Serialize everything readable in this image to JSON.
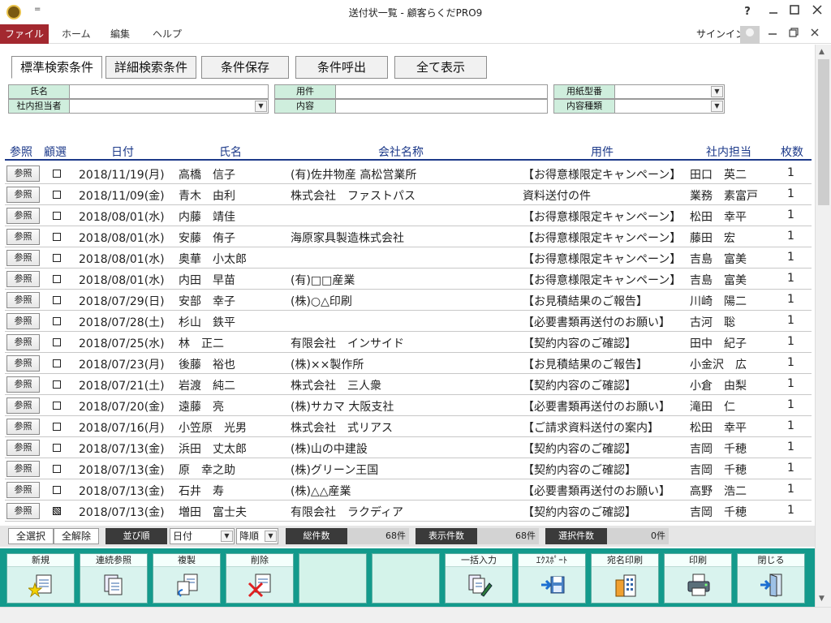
{
  "window": {
    "title": "送付状一覧 - 顧客らくだPRO9",
    "qat_symbol": "=",
    "help_icon": "?",
    "controls": [
      "minimize-icon",
      "maximize-icon",
      "close-icon"
    ]
  },
  "menu": {
    "items": [
      "ファイル",
      "ホーム",
      "編集",
      "ヘルプ"
    ],
    "signin": "サインイン"
  },
  "tabs": [
    "標準検索条件",
    "詳細検索条件",
    "条件保存",
    "条件呼出",
    "全て表示"
  ],
  "filters": {
    "name_label": "氏名",
    "staff_label": "社内担当者",
    "subject_label": "用件",
    "content_label": "内容",
    "paper_label": "用紙型番",
    "content_type_label": "内容種類"
  },
  "columns": [
    "参照",
    "顧選",
    "日付",
    "氏名",
    "会社名称",
    "用件",
    "社内担当",
    "枚数"
  ],
  "ref_label": "参照",
  "rows": [
    {
      "sel": false,
      "date": "2018/11/19(月)",
      "name": "高橋　信子",
      "company": "(有)佐井物産 高松営業所",
      "subject": "【お得意様限定キャンペーン】",
      "staff": "田口　英二",
      "count": "1"
    },
    {
      "sel": false,
      "date": "2018/11/09(金)",
      "name": "青木　由利",
      "company": "株式会社　ファストパス",
      "subject": "資料送付の件",
      "staff": "業務　素富戸",
      "count": "1"
    },
    {
      "sel": false,
      "date": "2018/08/01(水)",
      "name": "内藤　靖佳",
      "company": "",
      "subject": "【お得意様限定キャンペーン】",
      "staff": "松田　幸平",
      "count": "1"
    },
    {
      "sel": false,
      "date": "2018/08/01(水)",
      "name": "安藤　侑子",
      "company": "海原家具製造株式会社",
      "subject": "【お得意様限定キャンペーン】",
      "staff": "藤田　宏",
      "count": "1"
    },
    {
      "sel": false,
      "date": "2018/08/01(水)",
      "name": "奥華　小太郎",
      "company": "",
      "subject": "【お得意様限定キャンペーン】",
      "staff": "吉島　富美",
      "count": "1"
    },
    {
      "sel": false,
      "date": "2018/08/01(水)",
      "name": "内田　早苗",
      "company": "(有)□□産業",
      "subject": "【お得意様限定キャンペーン】",
      "staff": "吉島　富美",
      "count": "1"
    },
    {
      "sel": false,
      "date": "2018/07/29(日)",
      "name": "安部　幸子",
      "company": "(株)○△印刷",
      "subject": "【お見積結果のご報告】",
      "staff": "川崎　陽二",
      "count": "1"
    },
    {
      "sel": false,
      "date": "2018/07/28(土)",
      "name": "杉山　鉄平",
      "company": "",
      "subject": "【必要書類再送付のお願い】",
      "staff": "古河　聡",
      "count": "1"
    },
    {
      "sel": false,
      "date": "2018/07/25(水)",
      "name": "林　正二",
      "company": "有限会社　インサイド",
      "subject": "【契約内容のご確認】",
      "staff": "田中　紀子",
      "count": "1"
    },
    {
      "sel": false,
      "date": "2018/07/23(月)",
      "name": "後藤　裕也",
      "company": "(株)××製作所",
      "subject": "【お見積結果のご報告】",
      "staff": "小金沢　広",
      "count": "1"
    },
    {
      "sel": false,
      "date": "2018/07/21(土)",
      "name": "岩渡　純二",
      "company": "株式会社　三人衆",
      "subject": "【契約内容のご確認】",
      "staff": "小倉　由梨",
      "count": "1"
    },
    {
      "sel": false,
      "date": "2018/07/20(金)",
      "name": "遠藤　亮",
      "company": "(株)サカマ 大阪支社",
      "subject": "【必要書類再送付のお願い】",
      "staff": "滝田　仁",
      "count": "1"
    },
    {
      "sel": false,
      "date": "2018/07/16(月)",
      "name": "小笠原　光男",
      "company": "株式会社　式リアス",
      "subject": "【ご請求資料送付の案内】",
      "staff": "松田　幸平",
      "count": "1"
    },
    {
      "sel": false,
      "date": "2018/07/13(金)",
      "name": "浜田　丈太郎",
      "company": "(株)山の中建設",
      "subject": "【契約内容のご確認】",
      "staff": "吉岡　千穂",
      "count": "1"
    },
    {
      "sel": false,
      "date": "2018/07/13(金)",
      "name": "原　幸之助",
      "company": "(株)グリーン王国",
      "subject": "【契約内容のご確認】",
      "staff": "吉岡　千穂",
      "count": "1"
    },
    {
      "sel": false,
      "date": "2018/07/13(金)",
      "name": "石井　寿",
      "company": "(株)△△産業",
      "subject": "【必要書類再送付のお願い】",
      "staff": "高野　浩二",
      "count": "1"
    },
    {
      "sel": true,
      "date": "2018/07/13(金)",
      "name": "増田　富士夫",
      "company": "有限会社　ラクディア",
      "subject": "【契約内容のご確認】",
      "staff": "吉岡　千穂",
      "count": "1"
    }
  ],
  "status": {
    "select_all": "全選択",
    "deselect_all": "全解除",
    "sort_label": "並び順",
    "sort_field": "日付",
    "sort_order": "降順",
    "total_label": "総件数",
    "total_value": "68件",
    "shown_label": "表示件数",
    "shown_value": "68件",
    "selected_label": "選択件数",
    "selected_value": "0件"
  },
  "toolbar": [
    "新規",
    "連続参照",
    "複製",
    "削除",
    "",
    "",
    "一括入力",
    "ｴｸｽﾎﾟｰﾄ",
    "宛名印刷",
    "印刷",
    "閉じる"
  ],
  "colors": {
    "menu_file_bg": "#a3282f",
    "header_text": "#1d3a8a",
    "filter_label_bg": "#cfeedd",
    "toolbar_bg": "#139a8c"
  }
}
